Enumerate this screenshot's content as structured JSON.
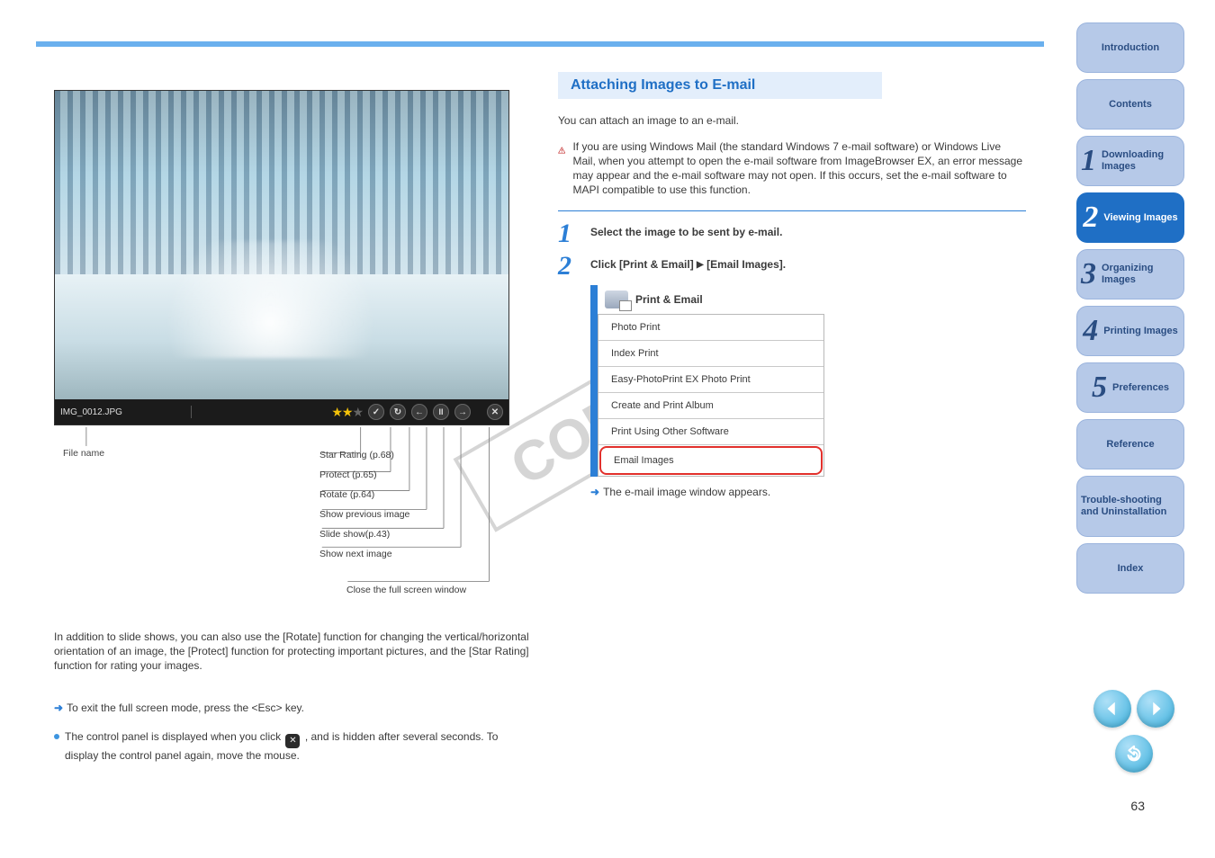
{
  "page_number": "63",
  "top_rule": true,
  "sidebar": {
    "intro_label": "Introduction",
    "contents_label": "Contents",
    "tabs": [
      {
        "num": "1",
        "label": "Downloading Images"
      },
      {
        "num": "2",
        "label": "Viewing Images"
      },
      {
        "num": "3",
        "label": "Organizing Images"
      },
      {
        "num": "4",
        "label": "Printing Images"
      },
      {
        "num": "5",
        "label": "Preferences"
      }
    ],
    "reference_label": "Reference",
    "troubleshoot_label": "Trouble-shooting and Uninstallation",
    "index_label": "Index",
    "active_index": 1
  },
  "screenshot": {
    "filename": "IMG_0012.JPG",
    "star_rating": 2,
    "star_max": 3
  },
  "annotations": {
    "filename_label": "File name",
    "stack": [
      "Star Rating (p.68)",
      "Protect (p.65)",
      "Rotate (p.64)",
      "Show previous image",
      "Slide show(p.43)",
      "Show next image",
      "Close the full screen window"
    ]
  },
  "paragraph": {
    "blurb": "In addition to slide shows, you can also use the [Rotate] function for changing the vertical/horizontal orientation of an image, the [Protect] function for protecting important pictures, and the [Star Rating] function for rating your images.",
    "arrow_line": "To exit the full screen mode, press the <Esc> key.",
    "bullet_pre": "The control panel is displayed when you click",
    "bullet_post": ", and is hidden after several seconds. To display the control panel again, move the mouse."
  },
  "right": {
    "title": "Attaching Images to E-mail",
    "intro": "You can attach an image to an e-mail.",
    "warn": "If you are using Windows Mail (the standard Windows 7 e-mail software) or Windows Live Mail, when you attempt to open the e-mail software from ImageBrowser EX, an error message may appear and the e-mail software may not open. If this occurs, set the e-mail software to MAPI compatible to use this function.",
    "step1": "Select the image to be sent by e-mail.",
    "step2_pre": "Click [Print & Email] ",
    "step2_tri": "▶",
    "step2_post": " [Email Images].",
    "menu": {
      "header": "Print & Email",
      "items": [
        "Photo Print",
        "Index Print",
        "Easy-PhotoPrint EX Photo Print",
        "Create and Print Album",
        "Print Using Other Software",
        "Email Images"
      ],
      "highlight_index": 5
    },
    "result_line": "The e-mail image window appears."
  }
}
